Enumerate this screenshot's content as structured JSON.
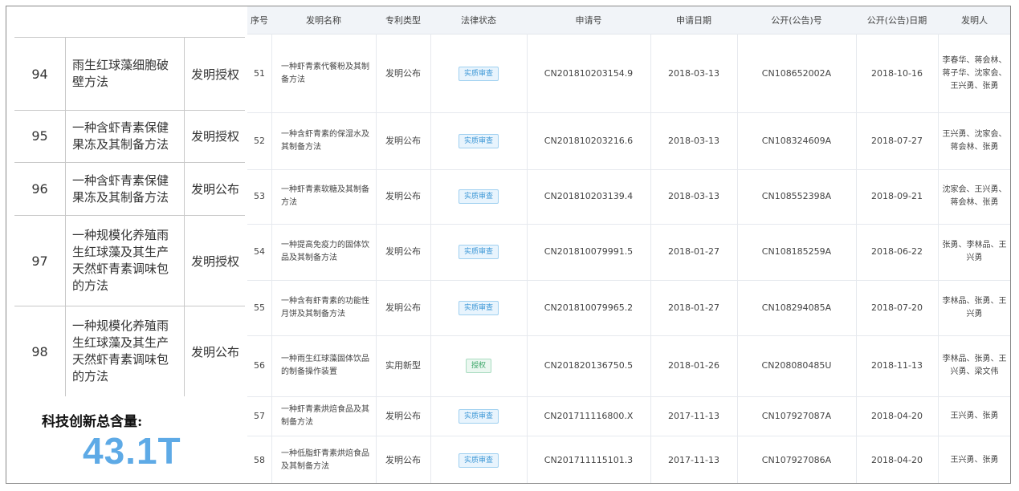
{
  "left_table": {
    "rows": [
      {
        "num": "94",
        "name": "雨生红球藻细胞破壁方法",
        "type": "发明授权"
      },
      {
        "num": "95",
        "name": "一种含虾青素保健果冻及其制备方法",
        "type": "发明授权"
      },
      {
        "num": "96",
        "name": "一种含虾青素保健果冻及其制备方法",
        "type": "发明公布"
      },
      {
        "num": "97",
        "name": "一种规模化养殖雨生红球藻及其生产天然虾青素调味包的方法",
        "type": "发明授权"
      },
      {
        "num": "98",
        "name": "一种规模化养殖雨生红球藻及其生产天然虾青素调味包的方法",
        "type": "发明公布"
      }
    ]
  },
  "summary": {
    "label": "科技创新总含量:",
    "value": "43.1T"
  },
  "patent_table": {
    "headers": [
      "序号",
      "发明名称",
      "专利类型",
      "法律状态",
      "申请号",
      "申请日期",
      "公开(公告)号",
      "公开(公告)日期",
      "发明人"
    ],
    "rows": [
      {
        "seq": "51",
        "name": "一种虾青素代餐粉及其制备方法",
        "type": "发明公布",
        "status": "实质审查",
        "status_kind": "review",
        "app_no": "CN201810203154.9",
        "app_date": "2018-03-13",
        "pub_no": "CN108652002A",
        "pub_date": "2018-10-16",
        "inventors": "李春华、蒋会林、蒋子华、沈家会、王兴勇、张勇"
      },
      {
        "seq": "52",
        "name": "一种含虾青素的保湿水及其制备方法",
        "type": "发明公布",
        "status": "实质审查",
        "status_kind": "review",
        "app_no": "CN201810203216.6",
        "app_date": "2018-03-13",
        "pub_no": "CN108324609A",
        "pub_date": "2018-07-27",
        "inventors": "王兴勇、沈家会、蒋会林、张勇"
      },
      {
        "seq": "53",
        "name": "一种虾青素软糖及其制备方法",
        "type": "发明公布",
        "status": "实质审查",
        "status_kind": "review",
        "app_no": "CN201810203139.4",
        "app_date": "2018-03-13",
        "pub_no": "CN108552398A",
        "pub_date": "2018-09-21",
        "inventors": "沈家会、王兴勇、蒋会林、张勇"
      },
      {
        "seq": "54",
        "name": "一种提高免疫力的固体饮品及其制备方法",
        "type": "发明公布",
        "status": "实质审查",
        "status_kind": "review",
        "app_no": "CN201810079991.5",
        "app_date": "2018-01-27",
        "pub_no": "CN108185259A",
        "pub_date": "2018-06-22",
        "inventors": "张勇、李林品、王兴勇"
      },
      {
        "seq": "55",
        "name": "一种含有虾青素的功能性月饼及其制备方法",
        "type": "发明公布",
        "status": "实质审查",
        "status_kind": "review",
        "app_no": "CN201810079965.2",
        "app_date": "2018-01-27",
        "pub_no": "CN108294085A",
        "pub_date": "2018-07-20",
        "inventors": "李林品、张勇、王兴勇"
      },
      {
        "seq": "56",
        "name": "一种雨生红球藻固体饮品的制备操作装置",
        "type": "实用新型",
        "status": "授权",
        "status_kind": "granted",
        "app_no": "CN201820136750.5",
        "app_date": "2018-01-26",
        "pub_no": "CN208080485U",
        "pub_date": "2018-11-13",
        "inventors": "李林品、张勇、王兴勇、梁文伟"
      },
      {
        "seq": "57",
        "name": "一种虾青素烘焙食品及其制备方法",
        "type": "发明公布",
        "status": "实质审查",
        "status_kind": "review",
        "app_no": "CN201711116800.X",
        "app_date": "2017-11-13",
        "pub_no": "CN107927087A",
        "pub_date": "2018-04-20",
        "inventors": "王兴勇、张勇"
      },
      {
        "seq": "58",
        "name": "一种低脂虾青素烘焙食品及其制备方法",
        "type": "发明公布",
        "status": "实质审查",
        "status_kind": "review",
        "app_no": "CN201711115101.3",
        "app_date": "2017-11-13",
        "pub_no": "CN107927086A",
        "pub_date": "2018-04-20",
        "inventors": "王兴勇、张勇"
      }
    ]
  }
}
